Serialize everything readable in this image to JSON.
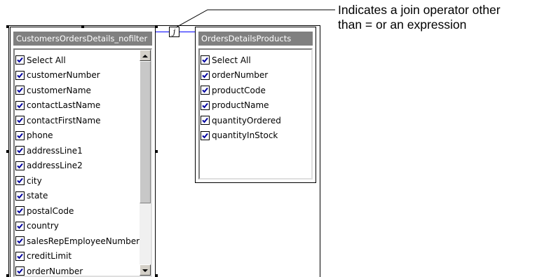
{
  "left_table": {
    "title": "CustomersOrdersDetails_nofilter",
    "items": [
      {
        "label": "Select All",
        "checked": true
      },
      {
        "label": "customerNumber",
        "checked": true
      },
      {
        "label": "customerName",
        "checked": true
      },
      {
        "label": "contactLastName",
        "checked": true
      },
      {
        "label": "contactFirstName",
        "checked": true
      },
      {
        "label": "phone",
        "checked": true
      },
      {
        "label": "addressLine1",
        "checked": true
      },
      {
        "label": "addressLine2",
        "checked": true
      },
      {
        "label": "city",
        "checked": true
      },
      {
        "label": "state",
        "checked": true
      },
      {
        "label": "postalCode",
        "checked": true
      },
      {
        "label": "country",
        "checked": true
      },
      {
        "label": "salesRepEmployeeNumber",
        "checked": true
      },
      {
        "label": "creditLimit",
        "checked": true
      },
      {
        "label": "orderNumber",
        "checked": true
      }
    ]
  },
  "right_table": {
    "title": "OrdersDetailsProducts",
    "items": [
      {
        "label": "Select All",
        "checked": true
      },
      {
        "label": "orderNumber",
        "checked": true
      },
      {
        "label": "productCode",
        "checked": true
      },
      {
        "label": "productName",
        "checked": true
      },
      {
        "label": "quantityOrdered",
        "checked": true
      },
      {
        "label": "quantityInStock",
        "checked": true
      }
    ]
  },
  "join_icon": {
    "glyph": "j",
    "icon": "join-operator-icon"
  },
  "callout": {
    "line1": "Indicates a join operator other",
    "line2": "than = or an expression"
  },
  "colors": {
    "title_bar": "#808080",
    "checkbox_mark": "#0000a0"
  }
}
